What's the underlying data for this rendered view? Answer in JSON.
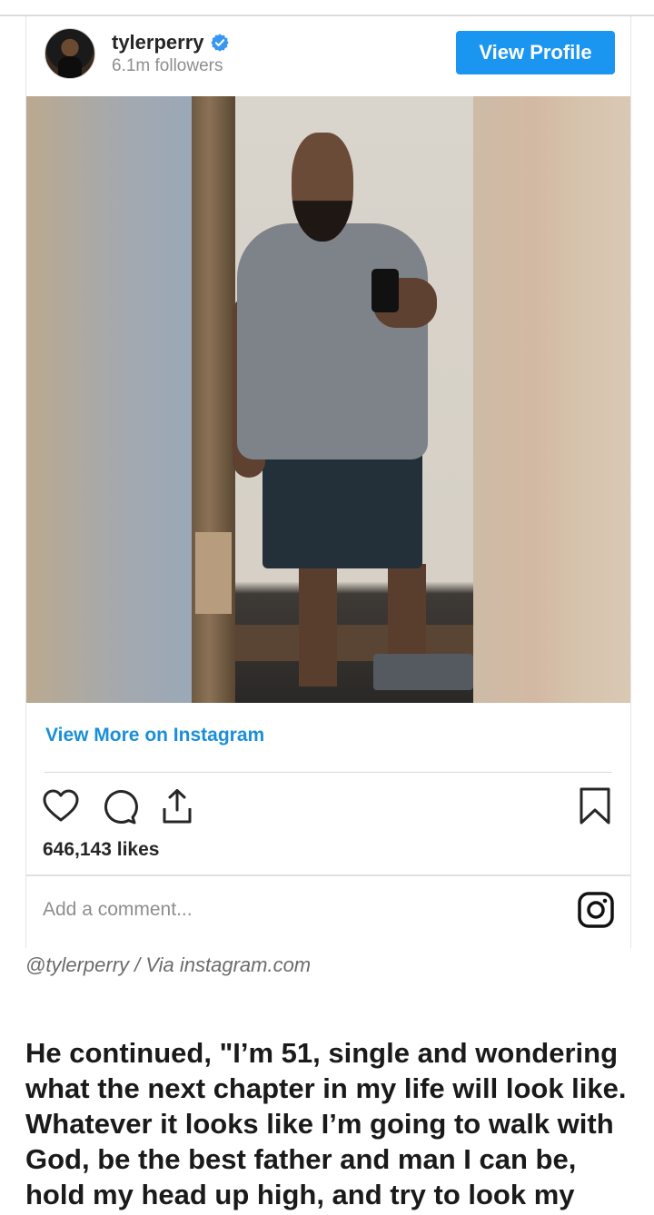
{
  "post": {
    "username": "tylerperry",
    "followers": "6.1m followers",
    "view_profile_label": "View Profile",
    "view_more_label": "View More on Instagram",
    "likes": "646,143 likes",
    "comment_placeholder": "Add a comment..."
  },
  "caption": {
    "source": "@tylerperry / Via instagram.com",
    "text": "He continued, \"I’m 51, single and wondering what the next chapter in my life will look like. Whatever it looks like I’m going to walk with God, be the best father and man I can be, hold my head up high, and try to look my"
  },
  "colors": {
    "accent": "#1a95f0",
    "link": "#1a8fd9",
    "verified": "#3897f0"
  },
  "icons": [
    "verified-badge-icon",
    "heart-icon",
    "comment-icon",
    "share-icon",
    "bookmark-icon",
    "instagram-logo-icon"
  ]
}
